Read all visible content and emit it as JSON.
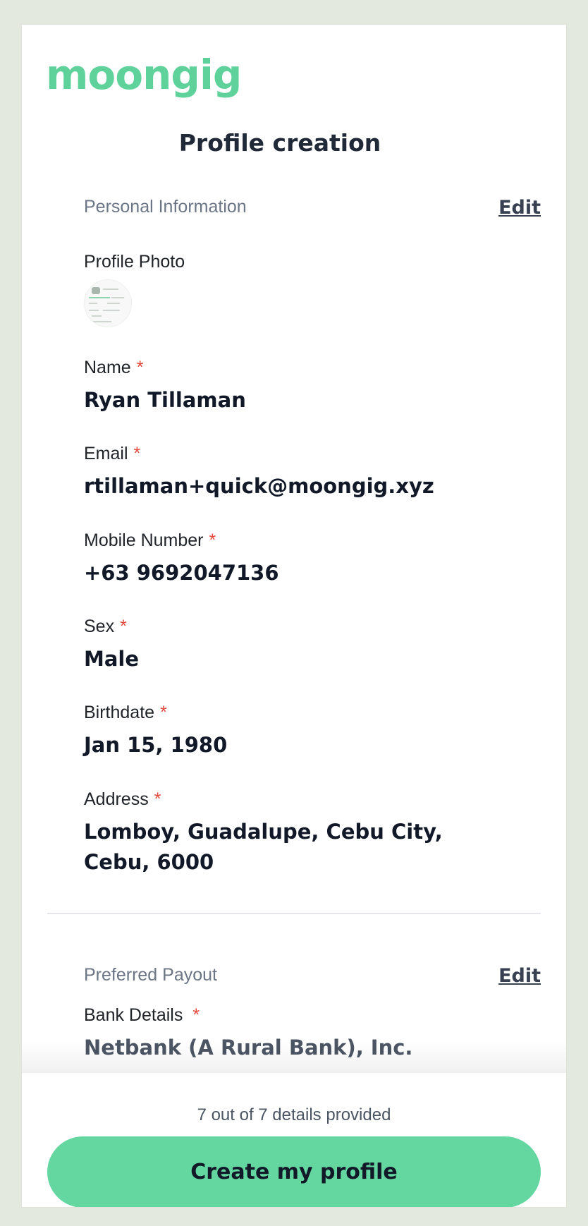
{
  "brand": {
    "logo_text": "moongig",
    "color": "#5fd19b"
  },
  "page": {
    "title": "Profile creation"
  },
  "personal": {
    "section_title": "Personal Information",
    "edit_label": "Edit",
    "photo_label": "Profile Photo",
    "fields": [
      {
        "label": "Name",
        "required_mark": "*",
        "value": "Ryan Tillaman"
      },
      {
        "label": "Email",
        "required_mark": "*",
        "value": "rtillaman+quick@moongig.xyz"
      },
      {
        "label": "Mobile Number",
        "required_mark": "*",
        "value": "+63 9692047136"
      },
      {
        "label": "Sex",
        "required_mark": "*",
        "value": "Male"
      },
      {
        "label": "Birthdate",
        "required_mark": "*",
        "value": "Jan 15, 1980"
      },
      {
        "label": "Address",
        "required_mark": "*",
        "value": "Lomboy, Guadalupe, Cebu City, Cebu, 6000"
      }
    ]
  },
  "payout": {
    "section_title": "Preferred Payout",
    "edit_label": "Edit",
    "bank_label": "Bank Details",
    "required_mark": "*",
    "bank_value": "Netbank (A Rural Bank), Inc."
  },
  "footer": {
    "progress_text": "7 out of 7 details provided",
    "button_label": "Create my profile",
    "button_color": "#64d7a1"
  }
}
